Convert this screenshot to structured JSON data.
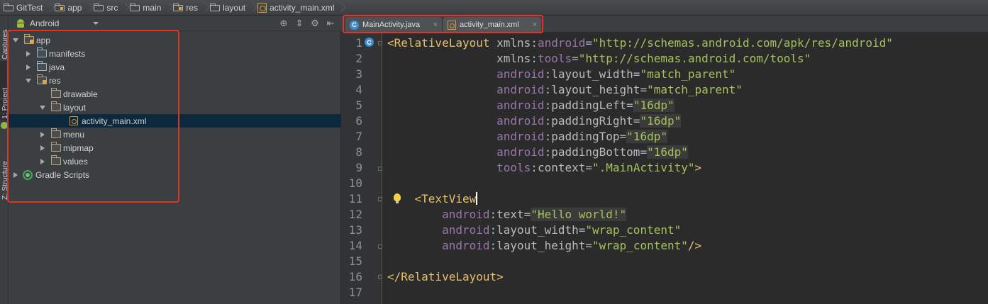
{
  "breadcrumb": [
    "GitTest",
    "app",
    "src",
    "main",
    "res",
    "layout",
    "activity_main.xml"
  ],
  "toolstrip": {
    "tab_captures": "Captures",
    "tab_project": "1: Project",
    "tab_structure": "Z: Structure"
  },
  "project_panel": {
    "view_mode": "Android",
    "header_tools": [
      "target-icon",
      "collapse-icon",
      "gear-icon",
      "hide-icon"
    ],
    "tree": [
      {
        "label": "app",
        "depth": 0,
        "expanded": true,
        "icon": "app-folder-icon"
      },
      {
        "label": "manifests",
        "depth": 1,
        "expanded": false,
        "icon": "folder-icon"
      },
      {
        "label": "java",
        "depth": 1,
        "expanded": false,
        "icon": "folder-icon"
      },
      {
        "label": "res",
        "depth": 1,
        "expanded": true,
        "icon": "res-folder-icon"
      },
      {
        "label": "drawable",
        "depth": 2,
        "expanded": null,
        "icon": "folder-icon"
      },
      {
        "label": "layout",
        "depth": 2,
        "expanded": true,
        "icon": "folder-icon"
      },
      {
        "label": "activity_main.xml",
        "depth": 3,
        "expanded": null,
        "icon": "xml-file-icon",
        "selected": true
      },
      {
        "label": "menu",
        "depth": 2,
        "expanded": false,
        "icon": "folder-icon"
      },
      {
        "label": "mipmap",
        "depth": 2,
        "expanded": false,
        "icon": "folder-icon"
      },
      {
        "label": "values",
        "depth": 2,
        "expanded": false,
        "icon": "folder-icon"
      },
      {
        "label": "Gradle Scripts",
        "depth": 0,
        "expanded": false,
        "icon": "gradle-icon"
      }
    ]
  },
  "editor_tabs": [
    {
      "label": "MainActivity.java",
      "icon": "java-class-icon",
      "close": "×"
    },
    {
      "label": "activity_main.xml",
      "icon": "xml-file-icon",
      "close": "×"
    }
  ],
  "gutter_class_badge": "C",
  "code_lines": [
    "<RelativeLayout xmlns:android=\"http://schemas.android.com/apk/res/android\"",
    "                xmlns:tools=\"http://schemas.android.com/tools\"",
    "                android:layout_width=\"match_parent\"",
    "                android:layout_height=\"match_parent\"",
    "                android:paddingLeft=\"16dp\"",
    "                android:paddingRight=\"16dp\"",
    "                android:paddingTop=\"16dp\"",
    "                android:paddingBottom=\"16dp\"",
    "                tools:context=\".MainActivity\">",
    "",
    "    <TextView",
    "        android:text=\"Hello world!\"",
    "        android:layout_width=\"wrap_content\"",
    "        android:layout_height=\"wrap_content\"/>",
    "",
    "</RelativeLayout>",
    ""
  ],
  "line_numbers": [
    "1",
    "2",
    "3",
    "4",
    "5",
    "6",
    "7",
    "8",
    "9",
    "10",
    "11",
    "12",
    "13",
    "14",
    "15",
    "16",
    "17"
  ],
  "colors": {
    "highlight_box": "#e2332a",
    "xml_tag": "#e8bf6a",
    "xml_namespace": "#9876aa",
    "xml_value": "#a5c25c"
  }
}
